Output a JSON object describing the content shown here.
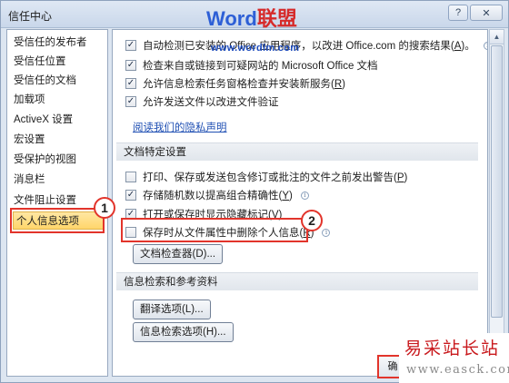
{
  "window": {
    "title": "信任中心"
  },
  "watermark": {
    "brand_latin": "Word",
    "brand_cjk": "联盟",
    "url": "www.wordlm.com",
    "corner_title": "易采站长站",
    "corner_url": "www.easck.com"
  },
  "titlebar_buttons": {
    "help": "?",
    "close": "✕"
  },
  "sidebar": {
    "items": [
      {
        "label": "受信任的发布者"
      },
      {
        "label": "受信任位置"
      },
      {
        "label": "受信任的文档"
      },
      {
        "label": "加载项"
      },
      {
        "label": "ActiveX 设置"
      },
      {
        "label": "宏设置"
      },
      {
        "label": "受保护的视图"
      },
      {
        "label": "消息栏"
      },
      {
        "label": "文件阻止设置"
      },
      {
        "label": "个人信息选项",
        "selected": true
      }
    ]
  },
  "privacy_section": {
    "items": [
      {
        "label": "自动检测已安装的 Office 应用程序，以改进 Office.com 的搜索结果(",
        "key": "A",
        "suffix": ")。",
        "checked": true,
        "info": true
      },
      {
        "label": "检查来自或链接到可疑网站的 Microsoft Office 文档",
        "key": "",
        "suffix": "",
        "checked": true,
        "info": false
      },
      {
        "label": "允许信息检索任务窗格检查并安装新服务(",
        "key": "R",
        "suffix": ")",
        "checked": true,
        "info": false
      },
      {
        "label": "允许发送文件以改进文件验证",
        "key": "",
        "suffix": "",
        "checked": true,
        "info": false
      }
    ],
    "privacy_link": "阅读我们的隐私声明"
  },
  "doc_section": {
    "header": "文档特定设置",
    "items": [
      {
        "label": "打印、保存或发送包含修订或批注的文件之前发出警告(",
        "key": "P",
        "suffix": ")",
        "checked": false,
        "info": false
      },
      {
        "label": "存储随机数以提高组合精确性(",
        "key": "Y",
        "suffix": ")",
        "checked": true,
        "info": true
      },
      {
        "label": "打开或保存时显示隐藏标记(",
        "key": "V",
        "suffix": ")",
        "checked": true,
        "info": false
      },
      {
        "label": "保存时从文件属性中删除个人信息(",
        "key": "R",
        "suffix": ")",
        "checked": false,
        "info": true
      }
    ],
    "inspector_button": "文档检查器(D)..."
  },
  "research_section": {
    "header": "信息检索和参考资料",
    "translate_button": "翻译选项(L)...",
    "research_button": "信息检索选项(H)..."
  },
  "annotations": {
    "badge_1": "1",
    "badge_2": "2"
  },
  "footer": {
    "ok_label": "确"
  },
  "colors": {
    "annotation_red": "#e2342b",
    "selection_yellow": "#ffd66b",
    "link_blue": "#1f4fb3"
  }
}
